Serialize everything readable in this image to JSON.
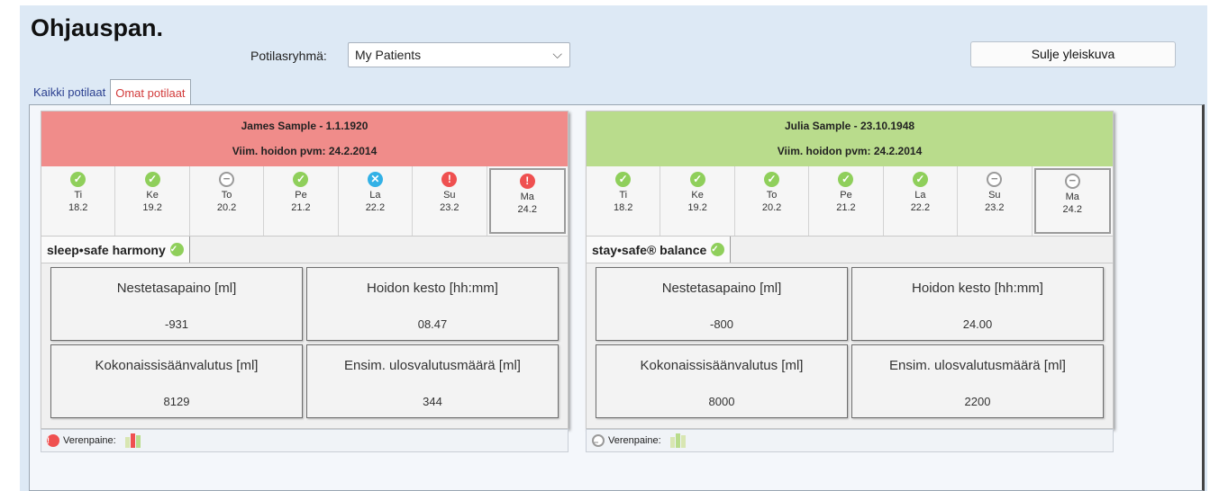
{
  "header": {
    "title": "Ohjauspan.",
    "group_label": "Potilasryhmä:",
    "group_value": "My Patients",
    "close_label": "Sulje yleiskuva"
  },
  "tabs": [
    {
      "label": "Kaikki potilaat",
      "active": false
    },
    {
      "label": "Omat potilaat",
      "active": true
    }
  ],
  "patients": [
    {
      "name_line": "James Sample - 1.1.1920",
      "date_line": "Viim. hoidon pvm: 24.2.2014",
      "head_color": "#f08c8a",
      "days": [
        {
          "day": "Ti",
          "date": "18.2",
          "status": "ok"
        },
        {
          "day": "Ke",
          "date": "19.2",
          "status": "ok"
        },
        {
          "day": "To",
          "date": "20.2",
          "status": "skip"
        },
        {
          "day": "Pe",
          "date": "21.2",
          "status": "ok"
        },
        {
          "day": "La",
          "date": "22.2",
          "status": "cancel"
        },
        {
          "day": "Su",
          "date": "23.2",
          "status": "warn"
        },
        {
          "day": "Ma",
          "date": "24.2",
          "status": "warn"
        }
      ],
      "device": "sleep•safe harmony",
      "metrics": [
        {
          "label": "Nestetasapaino [ml]",
          "value": "-931"
        },
        {
          "label": "Hoidon kesto [hh:mm]",
          "value": "08.47"
        },
        {
          "label": "Kokonaissisäänvalutus [ml]",
          "value": "8129"
        },
        {
          "label": "Ensim. ulosvalutusmäärä [ml]",
          "value": "344"
        }
      ],
      "footer_label": "Verenpaine:",
      "footer_status": "warn"
    },
    {
      "name_line": "Julia Sample - 23.10.1948",
      "date_line": "Viim. hoidon pvm: 24.2.2014",
      "head_color": "#b9dc8c",
      "days": [
        {
          "day": "Ti",
          "date": "18.2",
          "status": "ok"
        },
        {
          "day": "Ke",
          "date": "19.2",
          "status": "ok"
        },
        {
          "day": "To",
          "date": "20.2",
          "status": "ok"
        },
        {
          "day": "Pe",
          "date": "21.2",
          "status": "ok"
        },
        {
          "day": "La",
          "date": "22.2",
          "status": "ok"
        },
        {
          "day": "Su",
          "date": "23.2",
          "status": "skip"
        },
        {
          "day": "Ma",
          "date": "24.2",
          "status": "skip"
        }
      ],
      "device": "stay•safe® balance",
      "metrics": [
        {
          "label": "Nestetasapaino [ml]",
          "value": "-800"
        },
        {
          "label": "Hoidon kesto [hh:mm]",
          "value": "24.00"
        },
        {
          "label": "Kokonaissisäänvalutus [ml]",
          "value": "8000"
        },
        {
          "label": "Ensim. ulosvalutusmäärä [ml]",
          "value": "2200"
        }
      ],
      "footer_label": "Verenpaine:",
      "footer_status": "skip"
    }
  ]
}
